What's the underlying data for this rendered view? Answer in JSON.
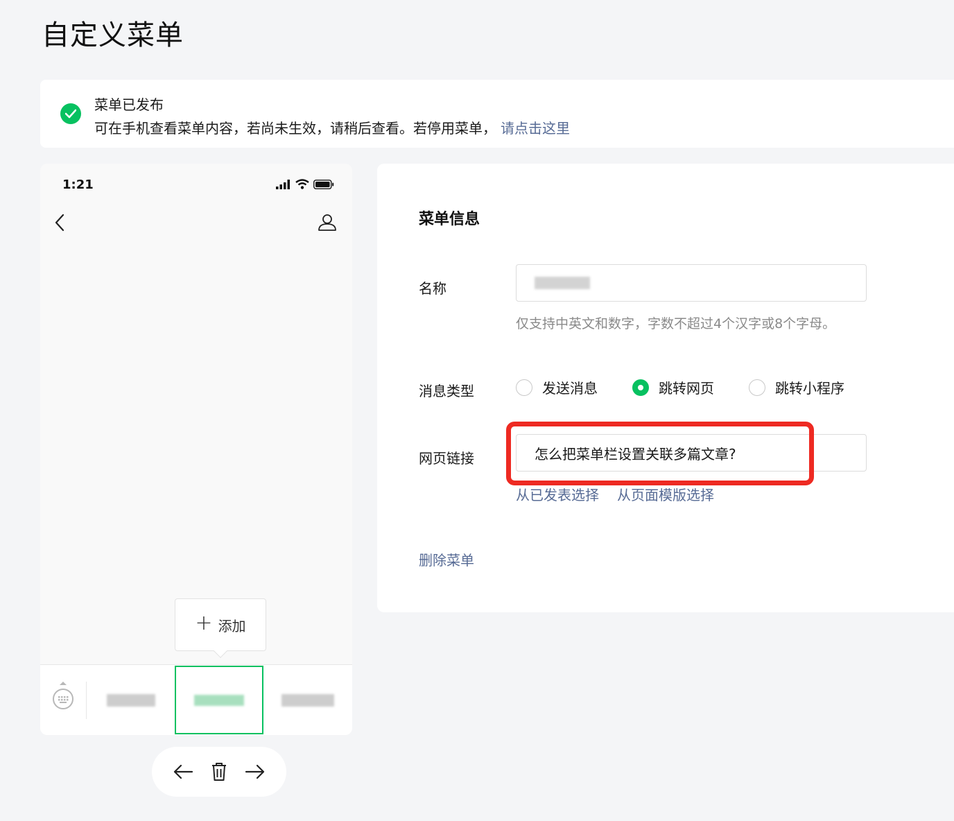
{
  "page": {
    "title": "自定义菜单"
  },
  "notice": {
    "title": "菜单已发布",
    "description": "可在手机查看菜单内容，若尚未生效，请稍后查看。若停用菜单，",
    "link": "请点击这里"
  },
  "phone": {
    "time": "1:21",
    "add_label": "添加",
    "add_plus": "+",
    "menu_items": [
      "",
      "",
      ""
    ]
  },
  "panel": {
    "heading": "菜单信息",
    "name_label": "名称",
    "name_value": "",
    "name_hint": "仅支持中英文和数字，字数不超过4个汉字或8个字母。",
    "type_label": "消息类型",
    "type_options": [
      "发送消息",
      "跳转网页",
      "跳转小程序"
    ],
    "type_selected": "跳转网页",
    "url_label": "网页链接",
    "url_value": "怎么把菜单栏设置关联多篇文章?",
    "link_published": "从已发表选择",
    "link_template": "从页面模版选择",
    "delete_label": "删除菜单"
  },
  "colors": {
    "accent": "#07c160",
    "link": "#576b95",
    "highlight": "#ee2a22"
  },
  "icons": [
    "check-icon",
    "signal-icon",
    "wifi-icon",
    "battery-icon",
    "back-icon",
    "profile-icon",
    "keyboard-icon",
    "arrow-left-icon",
    "trash-icon",
    "arrow-right-icon"
  ]
}
